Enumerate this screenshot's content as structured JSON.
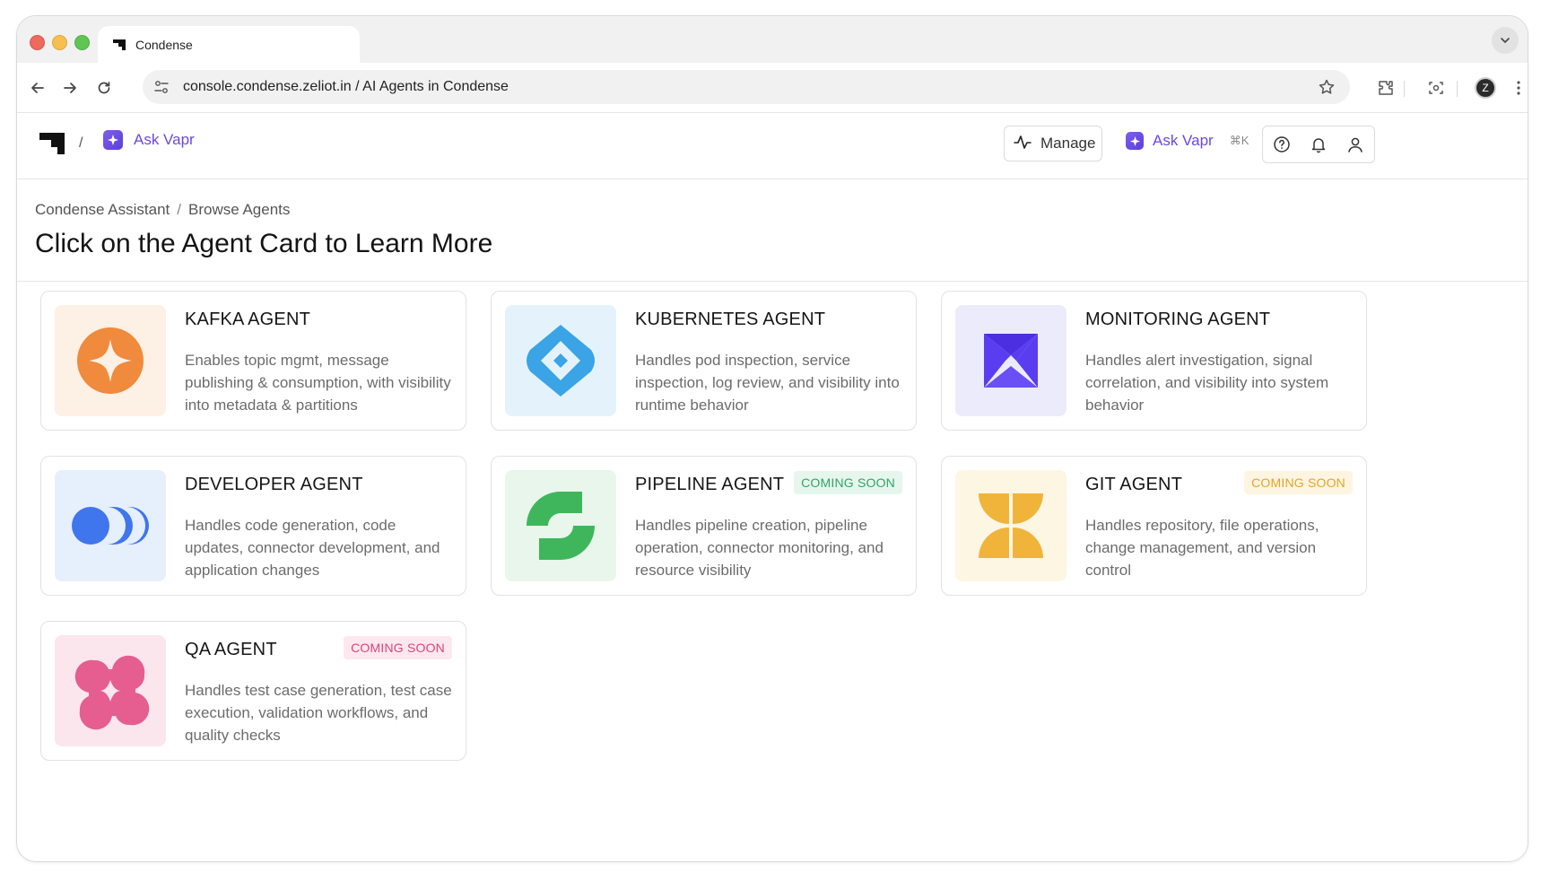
{
  "browser": {
    "tab_title": "Condense",
    "url_domain": "console.condense.zeliot.in",
    "url_separator": "/",
    "url_path": "AI Agents in Condense",
    "profile_initial": "Z"
  },
  "header": {
    "breadcrumb_sep": "/",
    "ask_vapr_label": "Ask Vapr",
    "manage_label": "Manage",
    "ask_vapr_right_label": "Ask Vapr",
    "shortcut": "⌘K"
  },
  "page": {
    "breadcrumb": [
      "Condense Assistant",
      "Browse Agents"
    ],
    "breadcrumb_sep": "/",
    "title": "Click on the Agent Card to Learn More"
  },
  "agents": [
    {
      "name": "KAFKA AGENT",
      "description": "Enables topic mgmt, message publishing & consumption, with visibility into metadata & partitions",
      "badge": "",
      "thumb_bg": "#fdf0e4",
      "accent": "#f08a3c"
    },
    {
      "name": "KUBERNETES AGENT",
      "description": "Handles pod inspection, service inspection, log review, and visibility into runtime behavior",
      "badge": "",
      "thumb_bg": "#e4f3fb",
      "accent": "#3aa4e6"
    },
    {
      "name": "MONITORING AGENT",
      "description": "Handles alert investigation, signal correlation, and visibility into system behavior",
      "badge": "",
      "thumb_bg": "#ecebfb",
      "accent": "#5a3df0"
    },
    {
      "name": "DEVELOPER AGENT",
      "description": "Handles code generation, code updates, connector development, and application changes",
      "badge": "",
      "thumb_bg": "#e6effc",
      "accent": "#3f76ee"
    },
    {
      "name": "PIPELINE AGENT",
      "description": "Handles pipeline creation, pipeline operation, connector monitoring, and resource visibility",
      "badge": "COMING SOON",
      "badge_color": "#33a36a",
      "badge_bg": "#e6f6ec",
      "thumb_bg": "#e8f6ec",
      "accent": "#3fb65b"
    },
    {
      "name": "GIT AGENT",
      "description": "Handles repository, file operations, change management, and version control",
      "badge": "COMING SOON",
      "badge_color": "#e2a52a",
      "badge_bg": "#fdf5e2",
      "thumb_bg": "#fdf6e3",
      "accent": "#f0b43a"
    },
    {
      "name": "QA AGENT",
      "description": "Handles test case generation, test case execution, validation workflows, and quality checks",
      "badge": "COMING SOON",
      "badge_color": "#d9457a",
      "badge_bg": "#fde8ef",
      "thumb_bg": "#fbe6ee",
      "accent": "#e55e8f"
    }
  ]
}
